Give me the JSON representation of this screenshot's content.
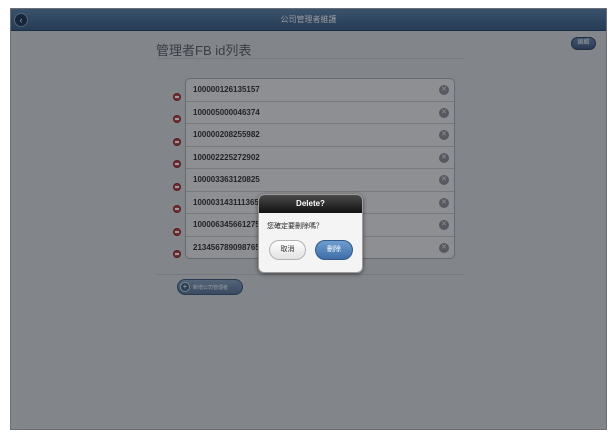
{
  "header": {
    "title": "公司管理者維護",
    "back_icon": "chevron-left-icon"
  },
  "toolbar": {
    "edit_label": "編輯"
  },
  "page": {
    "heading": "管理者FB id列表",
    "add_button_label": "新增公司管理者",
    "add_icon": "plus-icon"
  },
  "id_list": {
    "items": [
      "100000126135157",
      "100005000046374",
      "100000208255982",
      "100002225272902",
      "100003363120825",
      "100003143111365",
      "100006345661275",
      "213456789098765"
    ]
  },
  "dialog": {
    "title": "Delete?",
    "message": "您確定要刪除嗎？",
    "cancel_label": "取消",
    "confirm_label": "刪除"
  },
  "colors": {
    "header": "#4a6e96",
    "accent": "#3e6ea5",
    "delete_red": "#c24646"
  }
}
